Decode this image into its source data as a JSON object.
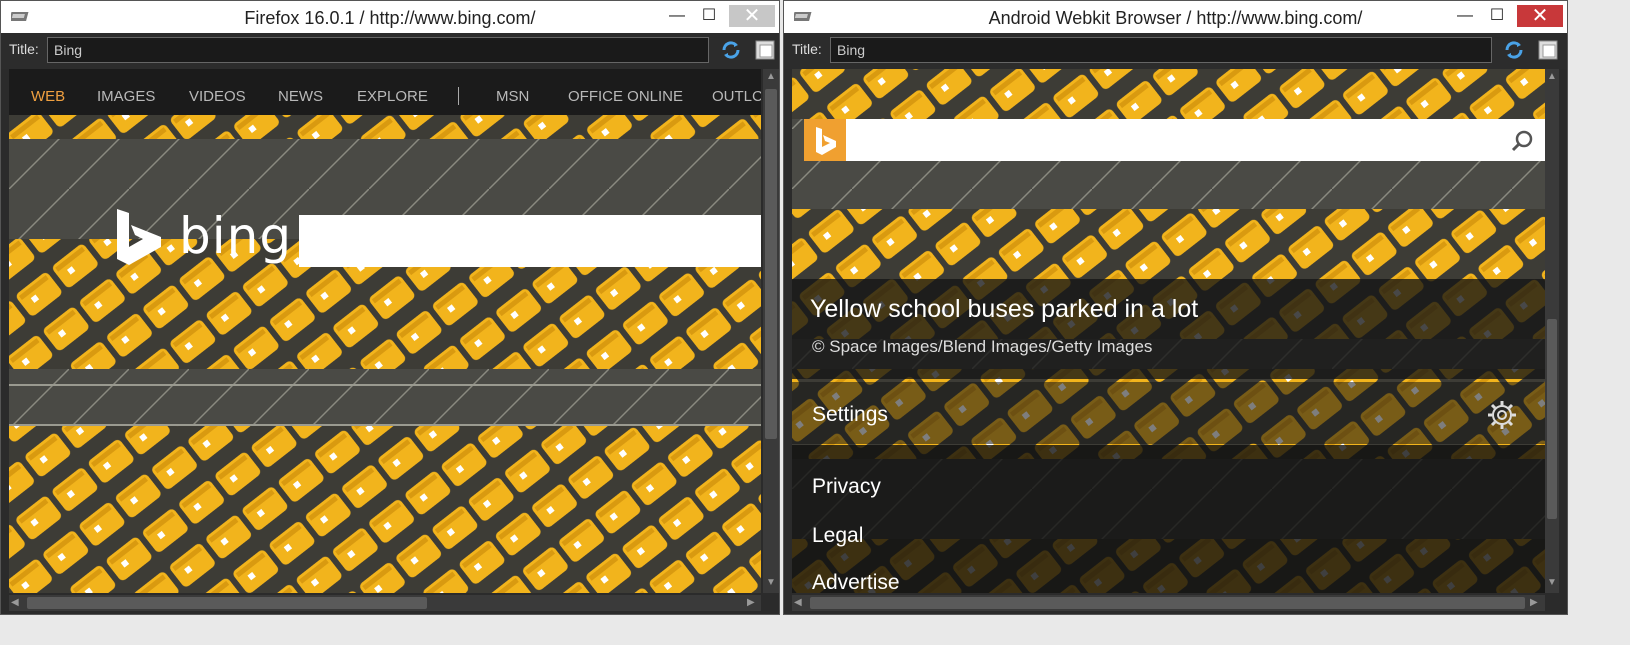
{
  "left_window": {
    "title": "Firefox 16.0.1 / http://www.bing.com/",
    "toolbar": {
      "title_label": "Title:",
      "title_value": "Bing"
    },
    "nav": {
      "items": [
        "WEB",
        "IMAGES",
        "VIDEOS",
        "NEWS",
        "EXPLORE",
        "MSN",
        "OFFICE ONLINE",
        "OUTLC"
      ]
    },
    "logo_text": "bing"
  },
  "right_window": {
    "title": "Android Webkit Browser / http://www.bing.com/",
    "toolbar": {
      "title_label": "Title:",
      "title_value": "Bing"
    },
    "image_caption": "Yellow school buses parked in a lot",
    "image_credit": "© Space Images/Blend Images/Getty Images",
    "menu": {
      "settings": "Settings",
      "privacy": "Privacy",
      "legal": "Legal",
      "advertise": "Advertise"
    }
  },
  "window_buttons": {
    "minimize": "—",
    "maximize": "☐",
    "close": "✕"
  },
  "colors": {
    "bing_orange": "#f0a040",
    "bus_yellow": "#f2b41c",
    "asphalt": "#3d3c36",
    "accent_nav": "#f0a040"
  },
  "icons": [
    "window-icon",
    "refresh-icon",
    "page-icon",
    "bing-logo-icon",
    "search-icon",
    "gear-icon"
  ]
}
